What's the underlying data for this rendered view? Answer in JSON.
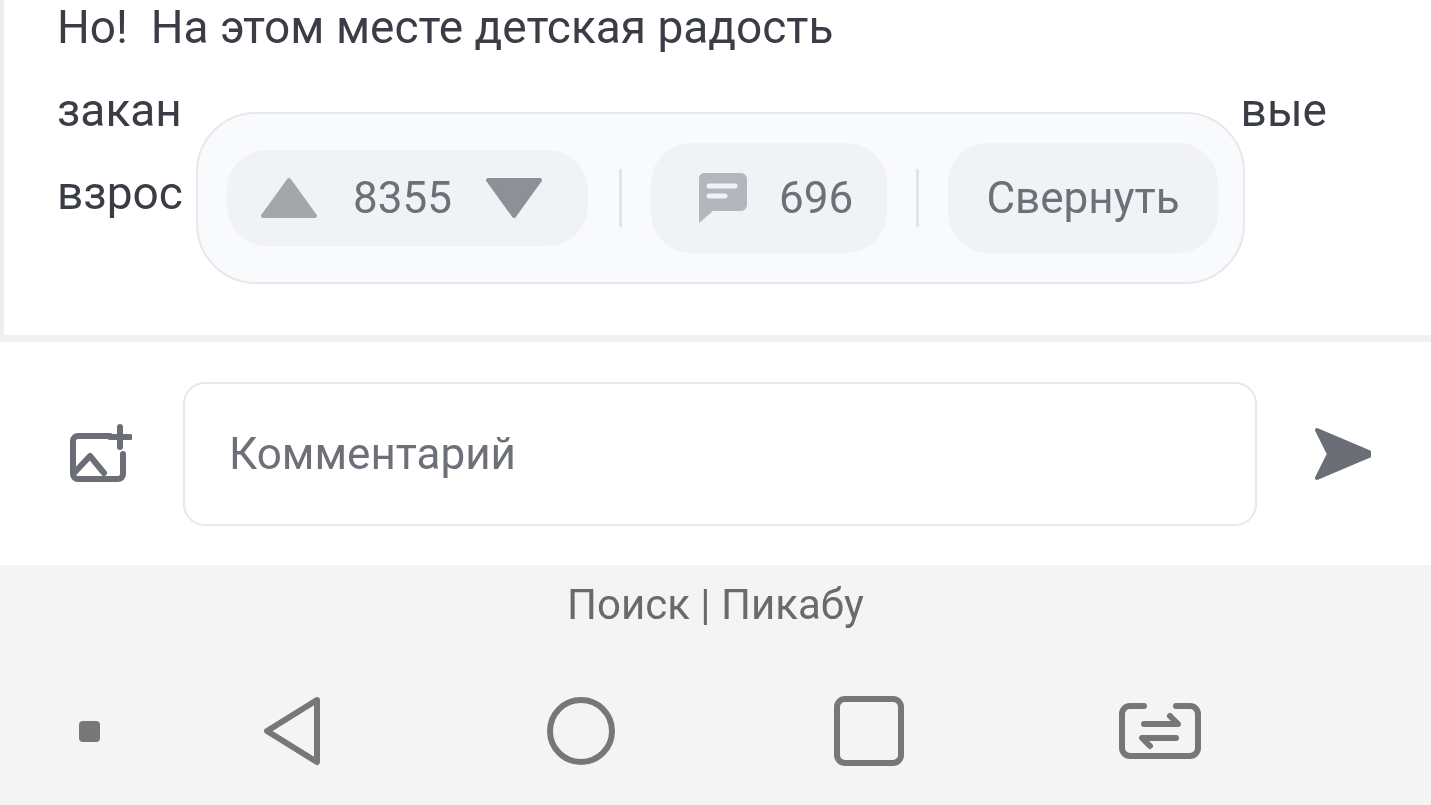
{
  "post": {
    "line_1": "Но!  На этом месте детская радость",
    "line_2": {
      "start": "закан",
      "end": "вые"
    },
    "line_3": "взрос"
  },
  "action_bar": {
    "rating": "8355",
    "comments": "696",
    "collapse": "Свернуть"
  },
  "comment_box": {
    "placeholder": "Комментарий"
  },
  "browser_bar": {
    "title": "Поиск | Пикабу"
  }
}
